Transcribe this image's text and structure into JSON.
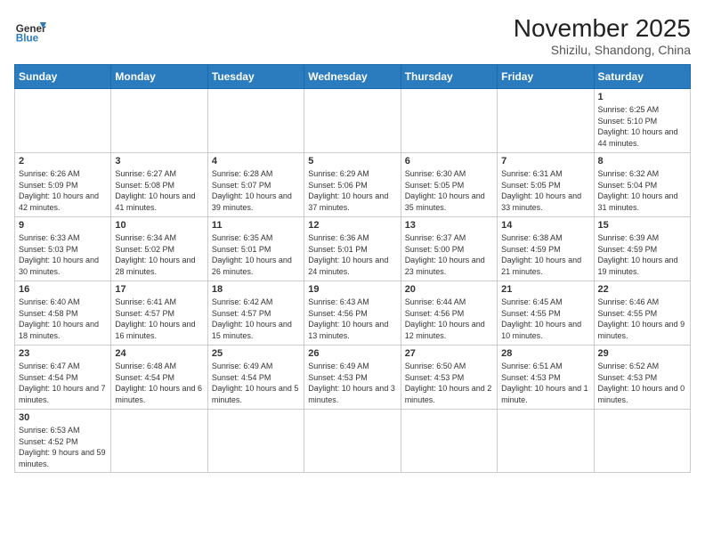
{
  "header": {
    "logo_general": "General",
    "logo_blue": "Blue",
    "month_year": "November 2025",
    "location": "Shizilu, Shandong, China"
  },
  "weekdays": [
    "Sunday",
    "Monday",
    "Tuesday",
    "Wednesday",
    "Thursday",
    "Friday",
    "Saturday"
  ],
  "weeks": [
    [
      {
        "day": "",
        "info": ""
      },
      {
        "day": "",
        "info": ""
      },
      {
        "day": "",
        "info": ""
      },
      {
        "day": "",
        "info": ""
      },
      {
        "day": "",
        "info": ""
      },
      {
        "day": "",
        "info": ""
      },
      {
        "day": "1",
        "info": "Sunrise: 6:25 AM\nSunset: 5:10 PM\nDaylight: 10 hours and 44 minutes."
      }
    ],
    [
      {
        "day": "2",
        "info": "Sunrise: 6:26 AM\nSunset: 5:09 PM\nDaylight: 10 hours and 42 minutes."
      },
      {
        "day": "3",
        "info": "Sunrise: 6:27 AM\nSunset: 5:08 PM\nDaylight: 10 hours and 41 minutes."
      },
      {
        "day": "4",
        "info": "Sunrise: 6:28 AM\nSunset: 5:07 PM\nDaylight: 10 hours and 39 minutes."
      },
      {
        "day": "5",
        "info": "Sunrise: 6:29 AM\nSunset: 5:06 PM\nDaylight: 10 hours and 37 minutes."
      },
      {
        "day": "6",
        "info": "Sunrise: 6:30 AM\nSunset: 5:05 PM\nDaylight: 10 hours and 35 minutes."
      },
      {
        "day": "7",
        "info": "Sunrise: 6:31 AM\nSunset: 5:05 PM\nDaylight: 10 hours and 33 minutes."
      },
      {
        "day": "8",
        "info": "Sunrise: 6:32 AM\nSunset: 5:04 PM\nDaylight: 10 hours and 31 minutes."
      }
    ],
    [
      {
        "day": "9",
        "info": "Sunrise: 6:33 AM\nSunset: 5:03 PM\nDaylight: 10 hours and 30 minutes."
      },
      {
        "day": "10",
        "info": "Sunrise: 6:34 AM\nSunset: 5:02 PM\nDaylight: 10 hours and 28 minutes."
      },
      {
        "day": "11",
        "info": "Sunrise: 6:35 AM\nSunset: 5:01 PM\nDaylight: 10 hours and 26 minutes."
      },
      {
        "day": "12",
        "info": "Sunrise: 6:36 AM\nSunset: 5:01 PM\nDaylight: 10 hours and 24 minutes."
      },
      {
        "day": "13",
        "info": "Sunrise: 6:37 AM\nSunset: 5:00 PM\nDaylight: 10 hours and 23 minutes."
      },
      {
        "day": "14",
        "info": "Sunrise: 6:38 AM\nSunset: 4:59 PM\nDaylight: 10 hours and 21 minutes."
      },
      {
        "day": "15",
        "info": "Sunrise: 6:39 AM\nSunset: 4:59 PM\nDaylight: 10 hours and 19 minutes."
      }
    ],
    [
      {
        "day": "16",
        "info": "Sunrise: 6:40 AM\nSunset: 4:58 PM\nDaylight: 10 hours and 18 minutes."
      },
      {
        "day": "17",
        "info": "Sunrise: 6:41 AM\nSunset: 4:57 PM\nDaylight: 10 hours and 16 minutes."
      },
      {
        "day": "18",
        "info": "Sunrise: 6:42 AM\nSunset: 4:57 PM\nDaylight: 10 hours and 15 minutes."
      },
      {
        "day": "19",
        "info": "Sunrise: 6:43 AM\nSunset: 4:56 PM\nDaylight: 10 hours and 13 minutes."
      },
      {
        "day": "20",
        "info": "Sunrise: 6:44 AM\nSunset: 4:56 PM\nDaylight: 10 hours and 12 minutes."
      },
      {
        "day": "21",
        "info": "Sunrise: 6:45 AM\nSunset: 4:55 PM\nDaylight: 10 hours and 10 minutes."
      },
      {
        "day": "22",
        "info": "Sunrise: 6:46 AM\nSunset: 4:55 PM\nDaylight: 10 hours and 9 minutes."
      }
    ],
    [
      {
        "day": "23",
        "info": "Sunrise: 6:47 AM\nSunset: 4:54 PM\nDaylight: 10 hours and 7 minutes."
      },
      {
        "day": "24",
        "info": "Sunrise: 6:48 AM\nSunset: 4:54 PM\nDaylight: 10 hours and 6 minutes."
      },
      {
        "day": "25",
        "info": "Sunrise: 6:49 AM\nSunset: 4:54 PM\nDaylight: 10 hours and 5 minutes."
      },
      {
        "day": "26",
        "info": "Sunrise: 6:49 AM\nSunset: 4:53 PM\nDaylight: 10 hours and 3 minutes."
      },
      {
        "day": "27",
        "info": "Sunrise: 6:50 AM\nSunset: 4:53 PM\nDaylight: 10 hours and 2 minutes."
      },
      {
        "day": "28",
        "info": "Sunrise: 6:51 AM\nSunset: 4:53 PM\nDaylight: 10 hours and 1 minute."
      },
      {
        "day": "29",
        "info": "Sunrise: 6:52 AM\nSunset: 4:53 PM\nDaylight: 10 hours and 0 minutes."
      }
    ],
    [
      {
        "day": "30",
        "info": "Sunrise: 6:53 AM\nSunset: 4:52 PM\nDaylight: 9 hours and 59 minutes."
      },
      {
        "day": "",
        "info": ""
      },
      {
        "day": "",
        "info": ""
      },
      {
        "day": "",
        "info": ""
      },
      {
        "day": "",
        "info": ""
      },
      {
        "day": "",
        "info": ""
      },
      {
        "day": "",
        "info": ""
      }
    ]
  ]
}
